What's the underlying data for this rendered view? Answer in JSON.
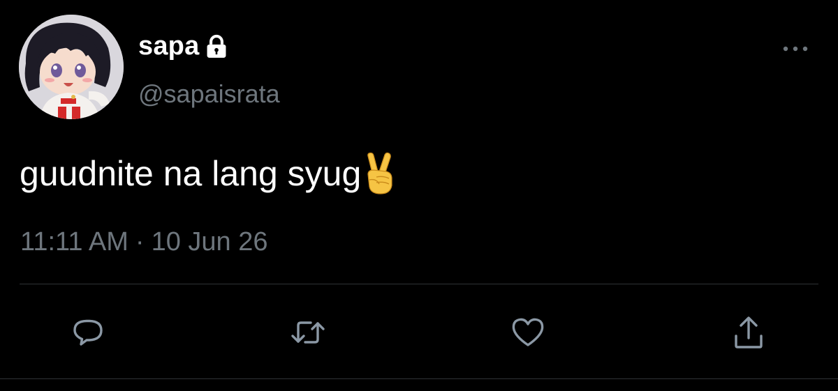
{
  "tweet": {
    "display_name": "sapa",
    "handle": "@sapaisrata",
    "text": "guudnite na lang syug",
    "emoji": "victory-hand",
    "time": "11:11 AM",
    "separator": "·",
    "date": "10 Jun 26"
  },
  "icons": {
    "protected": "lock-icon",
    "more": "more-icon",
    "reply": "reply-icon",
    "retweet": "retweet-icon",
    "like": "heart-icon",
    "share": "share-icon"
  },
  "colors": {
    "background": "#000000",
    "primary_text": "#ffffff",
    "secondary_text": "#6e767d",
    "divider": "#2f3336",
    "action_icon": "#8b98a5"
  }
}
